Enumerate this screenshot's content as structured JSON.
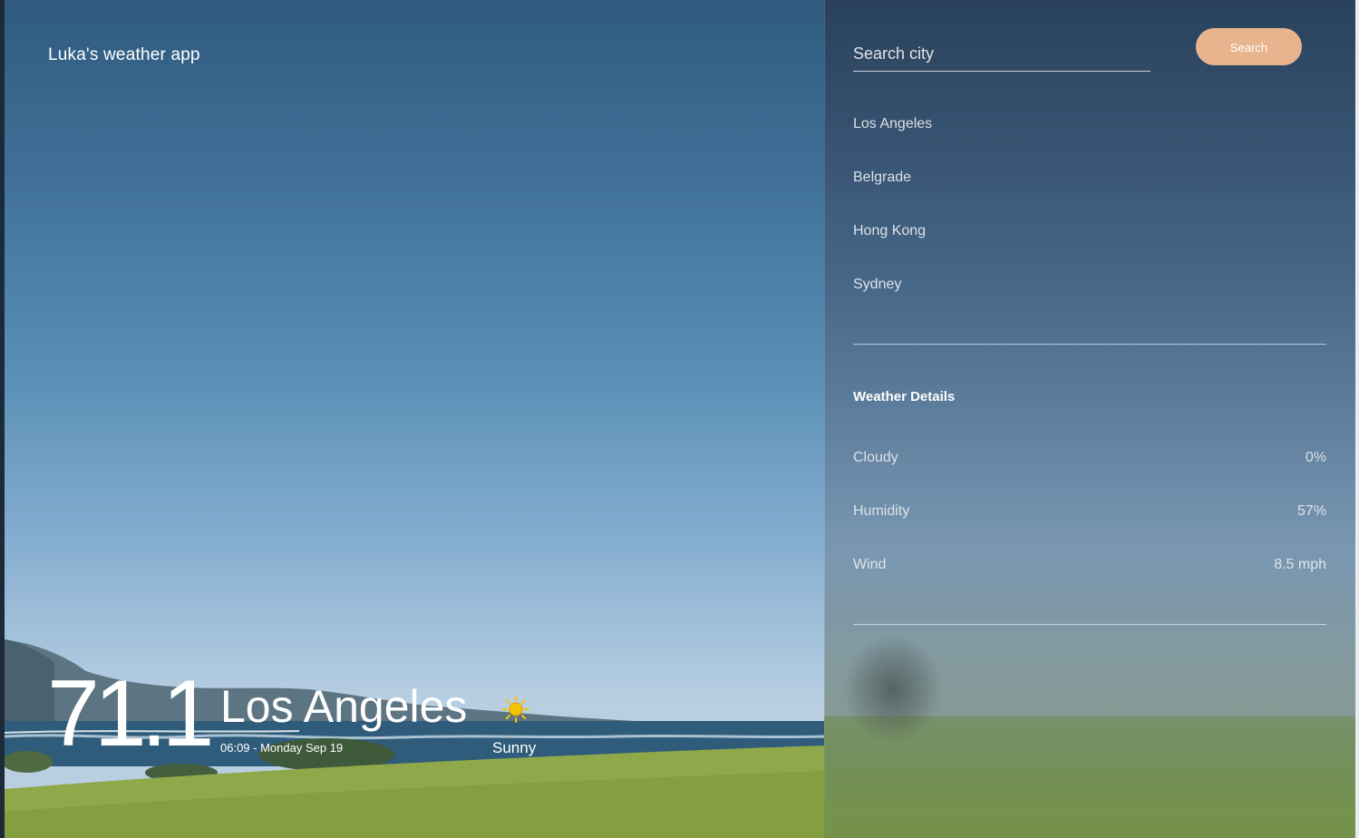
{
  "brand": {
    "title": "Luka's weather app"
  },
  "search": {
    "placeholder": "Search city",
    "value": "",
    "button_label": "Search"
  },
  "cities": [
    "Los Angeles",
    "Belgrade",
    "Hong Kong",
    "Sydney"
  ],
  "details": {
    "title": "Weather Details",
    "rows": [
      {
        "label": "Cloudy",
        "value": "0%"
      },
      {
        "label": "Humidity",
        "value": "57%"
      },
      {
        "label": "Wind",
        "value": "8.5 mph"
      }
    ]
  },
  "current": {
    "temperature": "71.1",
    "city": "Los Angeles",
    "datetime": "06:09 - Monday Sep 19",
    "condition": "Sunny",
    "condition_icon": "sun-icon"
  },
  "colors": {
    "accent": "#e8b48e",
    "text": "#ffffff",
    "sun": "#f5c400"
  }
}
